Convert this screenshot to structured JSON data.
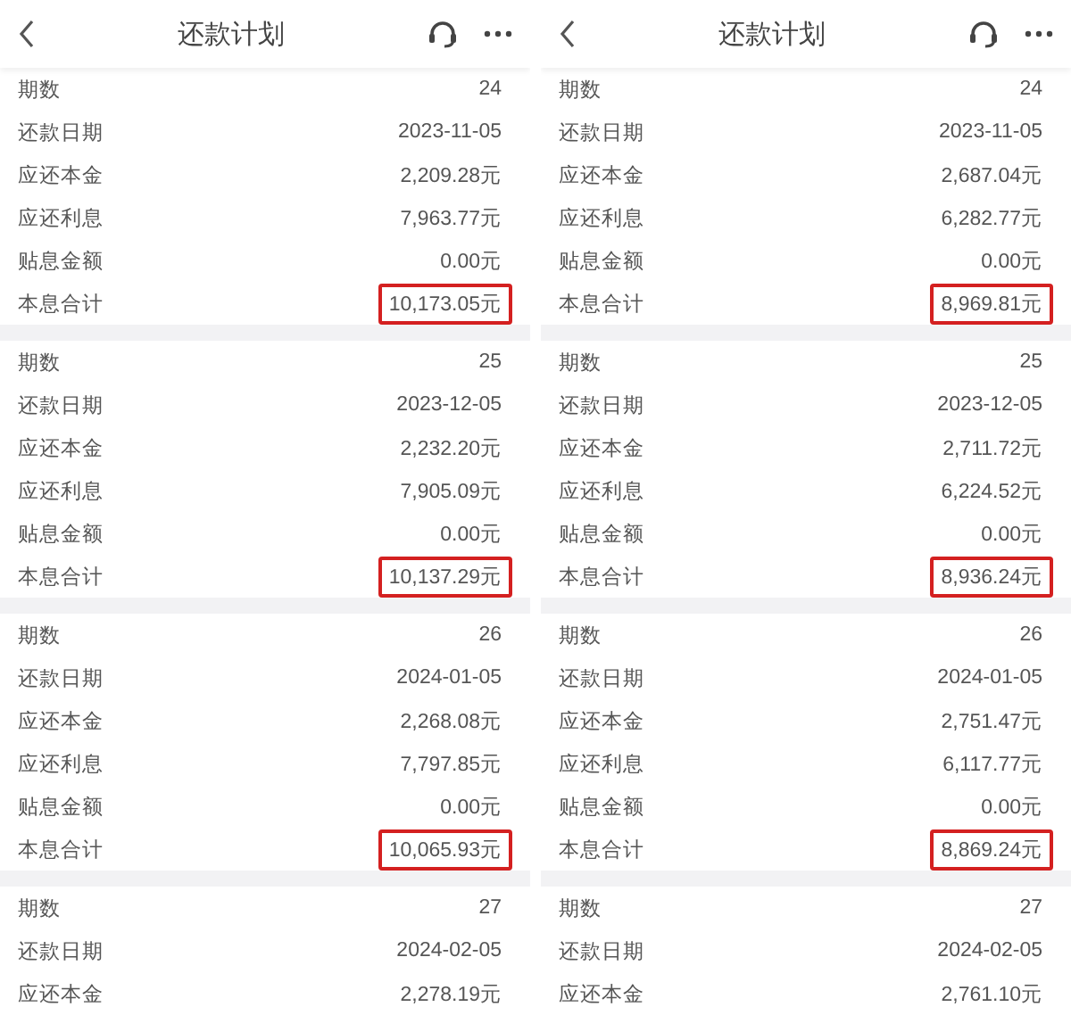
{
  "screens": [
    {
      "title": "还款计划",
      "groups": [
        {
          "rows": [
            {
              "label": "期数",
              "value": "24",
              "highlighted": false
            },
            {
              "label": "还款日期",
              "value": "2023-11-05",
              "highlighted": false
            },
            {
              "label": "应还本金",
              "value": "2,209.28元",
              "highlighted": false
            },
            {
              "label": "应还利息",
              "value": "7,963.77元",
              "highlighted": false
            },
            {
              "label": "贴息金额",
              "value": "0.00元",
              "highlighted": false
            },
            {
              "label": "本息合计",
              "value": "10,173.05元",
              "highlighted": true
            }
          ]
        },
        {
          "rows": [
            {
              "label": "期数",
              "value": "25",
              "highlighted": false
            },
            {
              "label": "还款日期",
              "value": "2023-12-05",
              "highlighted": false
            },
            {
              "label": "应还本金",
              "value": "2,232.20元",
              "highlighted": false
            },
            {
              "label": "应还利息",
              "value": "7,905.09元",
              "highlighted": false
            },
            {
              "label": "贴息金额",
              "value": "0.00元",
              "highlighted": false
            },
            {
              "label": "本息合计",
              "value": "10,137.29元",
              "highlighted": true
            }
          ]
        },
        {
          "rows": [
            {
              "label": "期数",
              "value": "26",
              "highlighted": false
            },
            {
              "label": "还款日期",
              "value": "2024-01-05",
              "highlighted": false
            },
            {
              "label": "应还本金",
              "value": "2,268.08元",
              "highlighted": false
            },
            {
              "label": "应还利息",
              "value": "7,797.85元",
              "highlighted": false
            },
            {
              "label": "贴息金额",
              "value": "0.00元",
              "highlighted": false
            },
            {
              "label": "本息合计",
              "value": "10,065.93元",
              "highlighted": true
            }
          ]
        },
        {
          "rows": [
            {
              "label": "期数",
              "value": "27",
              "highlighted": false
            },
            {
              "label": "还款日期",
              "value": "2024-02-05",
              "highlighted": false
            },
            {
              "label": "应还本金",
              "value": "2,278.19元",
              "highlighted": false
            }
          ]
        }
      ]
    },
    {
      "title": "还款计划",
      "groups": [
        {
          "rows": [
            {
              "label": "期数",
              "value": "24",
              "highlighted": false
            },
            {
              "label": "还款日期",
              "value": "2023-11-05",
              "highlighted": false
            },
            {
              "label": "应还本金",
              "value": "2,687.04元",
              "highlighted": false
            },
            {
              "label": "应还利息",
              "value": "6,282.77元",
              "highlighted": false
            },
            {
              "label": "贴息金额",
              "value": "0.00元",
              "highlighted": false
            },
            {
              "label": "本息合计",
              "value": "8,969.81元",
              "highlighted": true
            }
          ]
        },
        {
          "rows": [
            {
              "label": "期数",
              "value": "25",
              "highlighted": false
            },
            {
              "label": "还款日期",
              "value": "2023-12-05",
              "highlighted": false
            },
            {
              "label": "应还本金",
              "value": "2,711.72元",
              "highlighted": false
            },
            {
              "label": "应还利息",
              "value": "6,224.52元",
              "highlighted": false
            },
            {
              "label": "贴息金额",
              "value": "0.00元",
              "highlighted": false
            },
            {
              "label": "本息合计",
              "value": "8,936.24元",
              "highlighted": true
            }
          ]
        },
        {
          "rows": [
            {
              "label": "期数",
              "value": "26",
              "highlighted": false
            },
            {
              "label": "还款日期",
              "value": "2024-01-05",
              "highlighted": false
            },
            {
              "label": "应还本金",
              "value": "2,751.47元",
              "highlighted": false
            },
            {
              "label": "应还利息",
              "value": "6,117.77元",
              "highlighted": false
            },
            {
              "label": "贴息金额",
              "value": "0.00元",
              "highlighted": false
            },
            {
              "label": "本息合计",
              "value": "8,869.24元",
              "highlighted": true
            }
          ]
        },
        {
          "rows": [
            {
              "label": "期数",
              "value": "27",
              "highlighted": false
            },
            {
              "label": "还款日期",
              "value": "2024-02-05",
              "highlighted": false
            },
            {
              "label": "应还本金",
              "value": "2,761.10元",
              "highlighted": false
            }
          ]
        }
      ]
    }
  ]
}
